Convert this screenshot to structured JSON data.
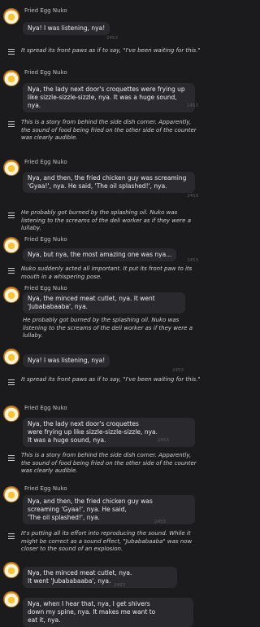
{
  "character": {
    "name": "Fried Egg Nuko",
    "timestamp_text": "2453"
  },
  "messages": [
    {
      "type": "chat",
      "text": "Nya! I was listening, nya!"
    },
    {
      "type": "narration",
      "text": "It spread its front paws as if to say, \"I've been waiting for this.\""
    },
    {
      "type": "chat",
      "text": "Nya, the lady next door's croquettes were frying up like sizzle-sizzle-sizzle, nya. It was a huge sound, nya."
    },
    {
      "type": "narration",
      "text": "This is a story from behind the side dish corner. Apparently, the sound of food being fried on the other side of the counter was clearly audible."
    },
    {
      "type": "chat",
      "text": "Nya, and then, the fried chicken guy was screaming 'Gyaa!', nya. He said, 'The oil splashed!', nya."
    },
    {
      "type": "narration",
      "text": "He probably got burned by the splashing oil. Nuko was listening to the screams of the deli worker as if they were a lullaby."
    },
    {
      "type": "chat",
      "text": "Nya, but nya, the most amazing one was nya..."
    },
    {
      "type": "narration",
      "text": "Nuko suddenly acted all important. It put its front paw to its mouth in a whispering pose."
    },
    {
      "type": "chat",
      "text": "Nya, the minced meat cutlet, nya. It went 'Jubababaaba', nya."
    },
    {
      "type": "inline_narration",
      "text": "He probably got burned by the splashing oil.\nNuko was listening to the screams of the deli worker as if they were a lullaby."
    },
    {
      "type": "chat",
      "text": "Nya! I was listening, nya!"
    },
    {
      "type": "narration",
      "text": "It spread its front paws as if to say,\n\"I've been waiting for this.\""
    },
    {
      "type": "chat",
      "text": "Nya, the lady next door's croquettes\nwere frying up like sizzle-sizzle-sizzle, nya.\nIt was a huge sound, nya."
    },
    {
      "type": "narration",
      "text": "This is a story from behind the side dish corner.\nApparently, the sound of food being fried on the other\nside of the counter was clearly audible."
    },
    {
      "type": "chat",
      "text": "Nya, and then, the fried chicken guy was\nscreaming 'Gyaa!', nya. He said,\n'The oil splashed!', nya."
    },
    {
      "type": "narration",
      "text": "It's putting all its effort into reproducing the sound.\nWhile it might be correct as a sound effect,\n\"Jubababaaba\" was now closer to the sound of an explosion."
    },
    {
      "type": "chat",
      "text": "Nya, the minced meat cutlet, nya.\nIt went 'Jubababaaba', nya."
    },
    {
      "type": "chat",
      "text": "Nya, when I hear that, nya, I get shivers\ndown my spine, nya. It makes me want to\neat it, nya."
    }
  ]
}
